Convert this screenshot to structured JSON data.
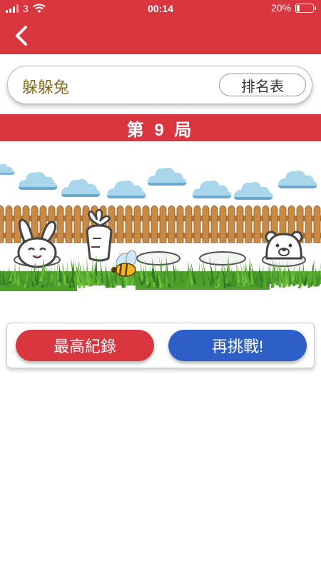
{
  "status": {
    "carrier": "3",
    "time": "00:14",
    "battery": "20%",
    "battery_fraction": 0.2
  },
  "header": {
    "back_icon": "chevron-left-icon",
    "color": "#d93640"
  },
  "title_card": {
    "title": "躲躲兔",
    "ranking_label": "排名表"
  },
  "round": {
    "label": "第 9 局"
  },
  "scene": {
    "elements": [
      "clouds",
      "wooden-fence",
      "rabbit",
      "carrot",
      "bee",
      "bear",
      "holes",
      "grass"
    ]
  },
  "actions": {
    "best_record_label": "最高紀錄",
    "retry_label": "再挑戰!"
  },
  "colors": {
    "brand_red": "#d93640",
    "retry_blue": "#2e5fc8",
    "title_gold": "#8a6d1f"
  }
}
